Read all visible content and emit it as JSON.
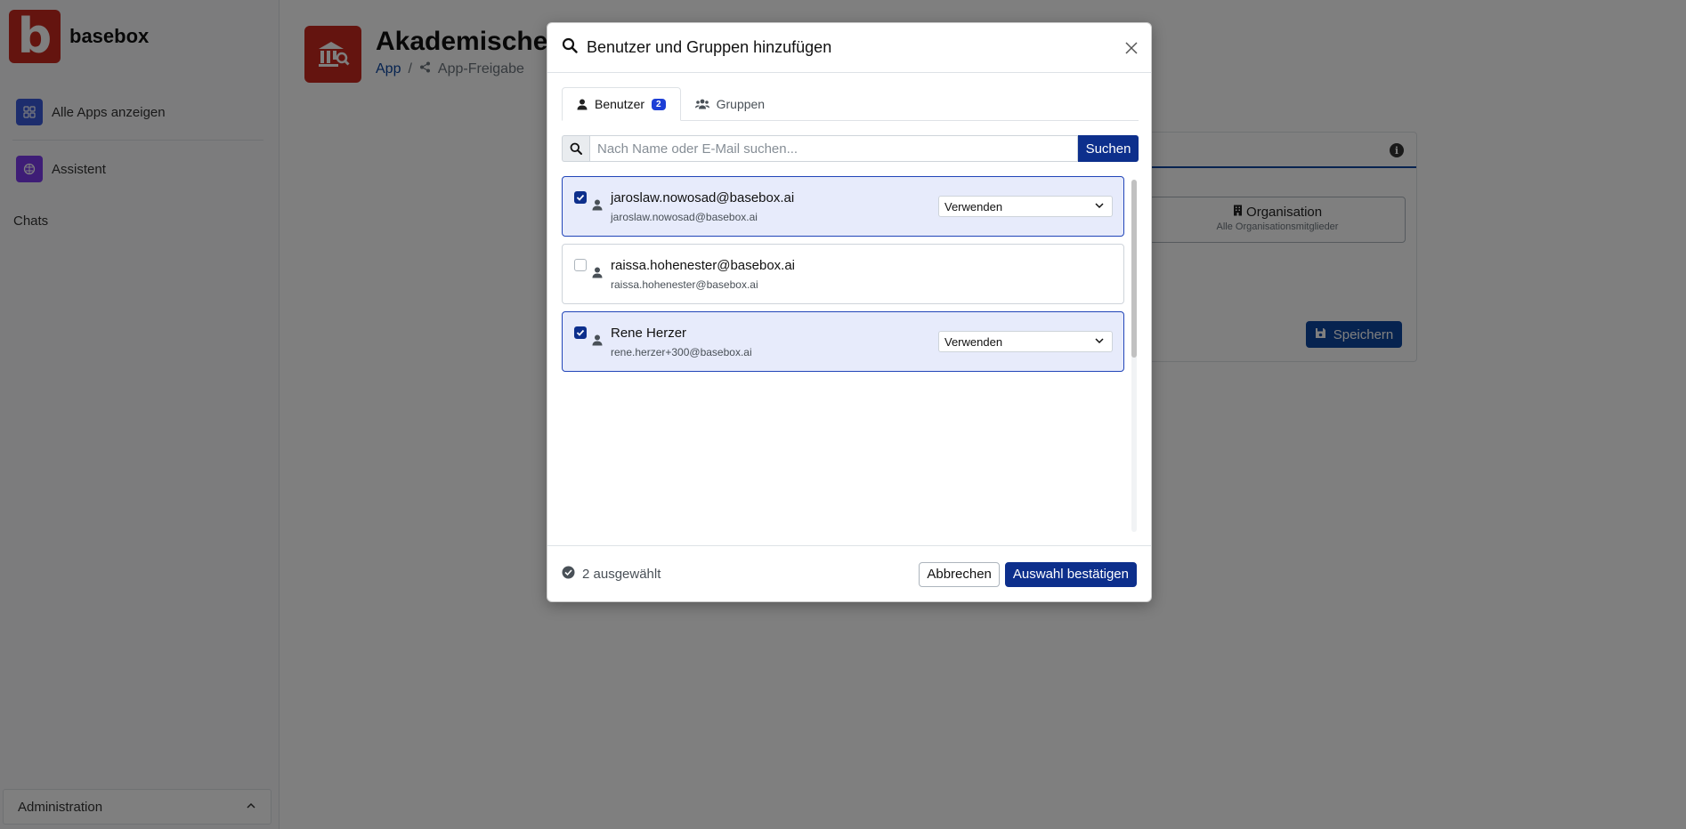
{
  "sidebar": {
    "brand": "basebox",
    "brand_letter": "b",
    "items": [
      {
        "label": "Alle Apps anzeigen"
      },
      {
        "label": "Assistent"
      }
    ],
    "chats_label": "Chats",
    "admin_label": "Administration"
  },
  "main": {
    "title": "Akademische",
    "breadcrumb": {
      "app": "App",
      "separator": "/",
      "current": "App-Freigabe"
    },
    "panel": {
      "org_title": "Organisation",
      "org_subtitle": "Alle Organisationsmitglieder",
      "save_label": "Speichern"
    }
  },
  "modal": {
    "title": "Benutzer und Gruppen hinzufügen",
    "tabs": [
      {
        "label": "Benutzer",
        "badge": "2",
        "active": true
      },
      {
        "label": "Gruppen",
        "active": false
      }
    ],
    "search": {
      "placeholder": "Nach Name oder E-Mail suchen...",
      "value": "",
      "button": "Suchen"
    },
    "users": [
      {
        "name": "jaroslaw.nowosad@basebox.ai",
        "email": "jaroslaw.nowosad@basebox.ai",
        "selected": true,
        "permission": "Verwenden"
      },
      {
        "name": "raissa.hohenester@basebox.ai",
        "email": "raissa.hohenester@basebox.ai",
        "selected": false,
        "permission": ""
      },
      {
        "name": "Rene Herzer",
        "email": "rene.herzer+300@basebox.ai",
        "selected": true,
        "permission": "Verwenden"
      }
    ],
    "footer": {
      "selected_count": "2 ausgewählt",
      "cancel": "Abbrechen",
      "confirm": "Auswahl bestätigen"
    }
  },
  "colors": {
    "brand_red": "#c8281e",
    "primary_blue": "#0d2f8c",
    "selected_row_bg": "#e7ebfb"
  }
}
